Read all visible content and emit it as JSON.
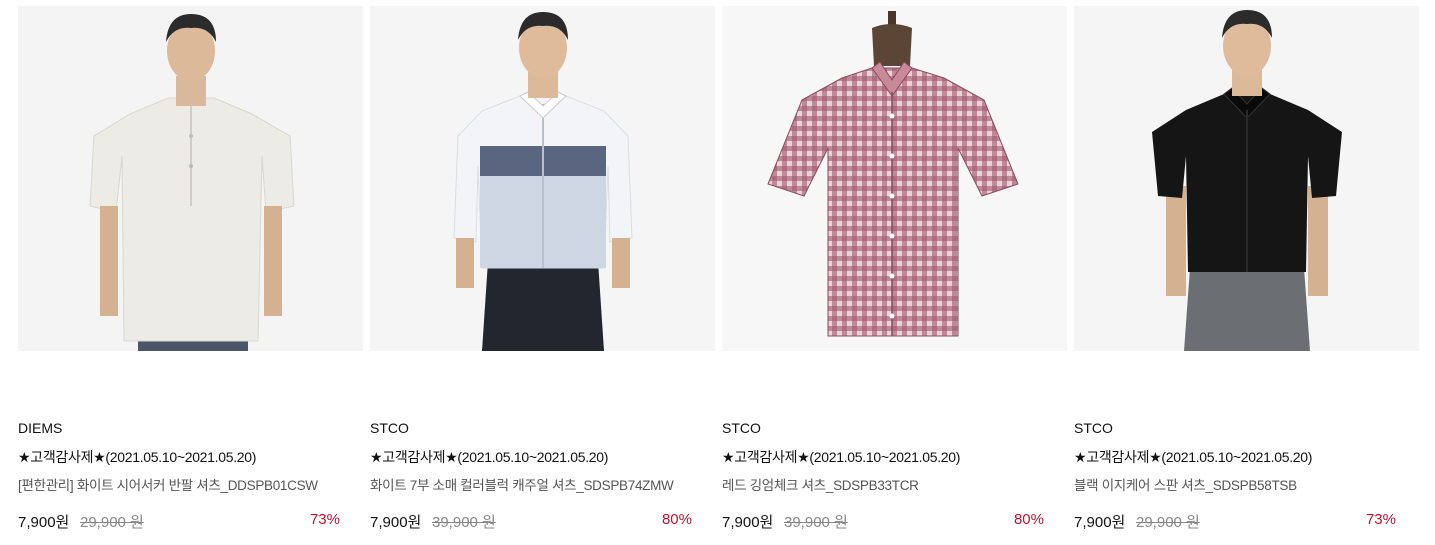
{
  "products": [
    {
      "brand": "DIEMS",
      "event": "★고객감사제★(2021.05.10~2021.05.20)",
      "name": "[편한관리] 화이트 시어서커 반팔 셔츠_DDSPB01CSW",
      "price": "7,900원",
      "original_price": "29,900 원",
      "discount": "73%",
      "image": "model-white-short-sleeve-shirt"
    },
    {
      "brand": "STCO",
      "event": "★고객감사제★(2021.05.10~2021.05.20)",
      "name": "화이트 7부 소매 컬러블럭 캐주얼 셔츠_SDSPB74ZMW",
      "price": "7,900원",
      "original_price": "39,900 원",
      "discount": "80%",
      "image": "model-colorblock-shirt"
    },
    {
      "brand": "STCO",
      "event": "★고객감사제★(2021.05.10~2021.05.20)",
      "name": "레드 깅엄체크 셔츠_SDSPB33TCR",
      "price": "7,900원",
      "original_price": "39,900 원",
      "discount": "80%",
      "image": "mannequin-red-gingham-shirt"
    },
    {
      "brand": "STCO",
      "event": "★고객감사제★(2021.05.10~2021.05.20)",
      "name": "블랙 이지케어 스판 셔츠_SDSPB58TSB",
      "price": "7,900원",
      "original_price": "29,900 원",
      "discount": "73%",
      "image": "model-black-short-sleeve-shirt"
    }
  ]
}
